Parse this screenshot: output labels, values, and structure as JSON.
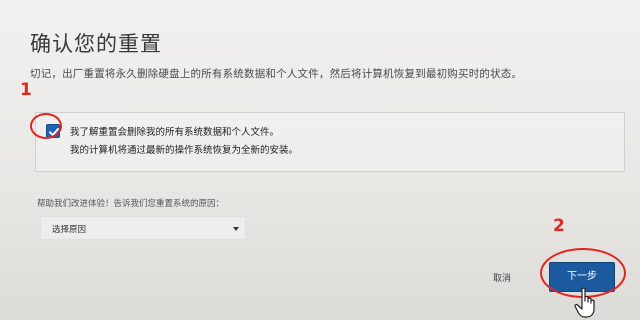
{
  "dialog": {
    "title": "确认您的重置",
    "warning": "切记，出厂重置将永久删除硬盘上的所有系统数据和个人文件，然后将计算机恢复到最初购买时的状态。"
  },
  "confirmation": {
    "checked": true,
    "label": "我了解重置会删除我的所有系统数据和个人文件。",
    "subtext": "我的计算机将通过最新的操作系统恢复为全新的安装。"
  },
  "feedback": {
    "prompt": "帮助我们改进体验！告诉我们您重置系统的原因：",
    "select_value": "选择原因"
  },
  "buttons": {
    "cancel": "取消",
    "next": "下一步"
  },
  "annotations": {
    "step1": "1",
    "step2": "2",
    "color": "#e3251f"
  },
  "colors": {
    "primary_button": "#1c5a9f",
    "checkbox": "#1e63b5"
  }
}
